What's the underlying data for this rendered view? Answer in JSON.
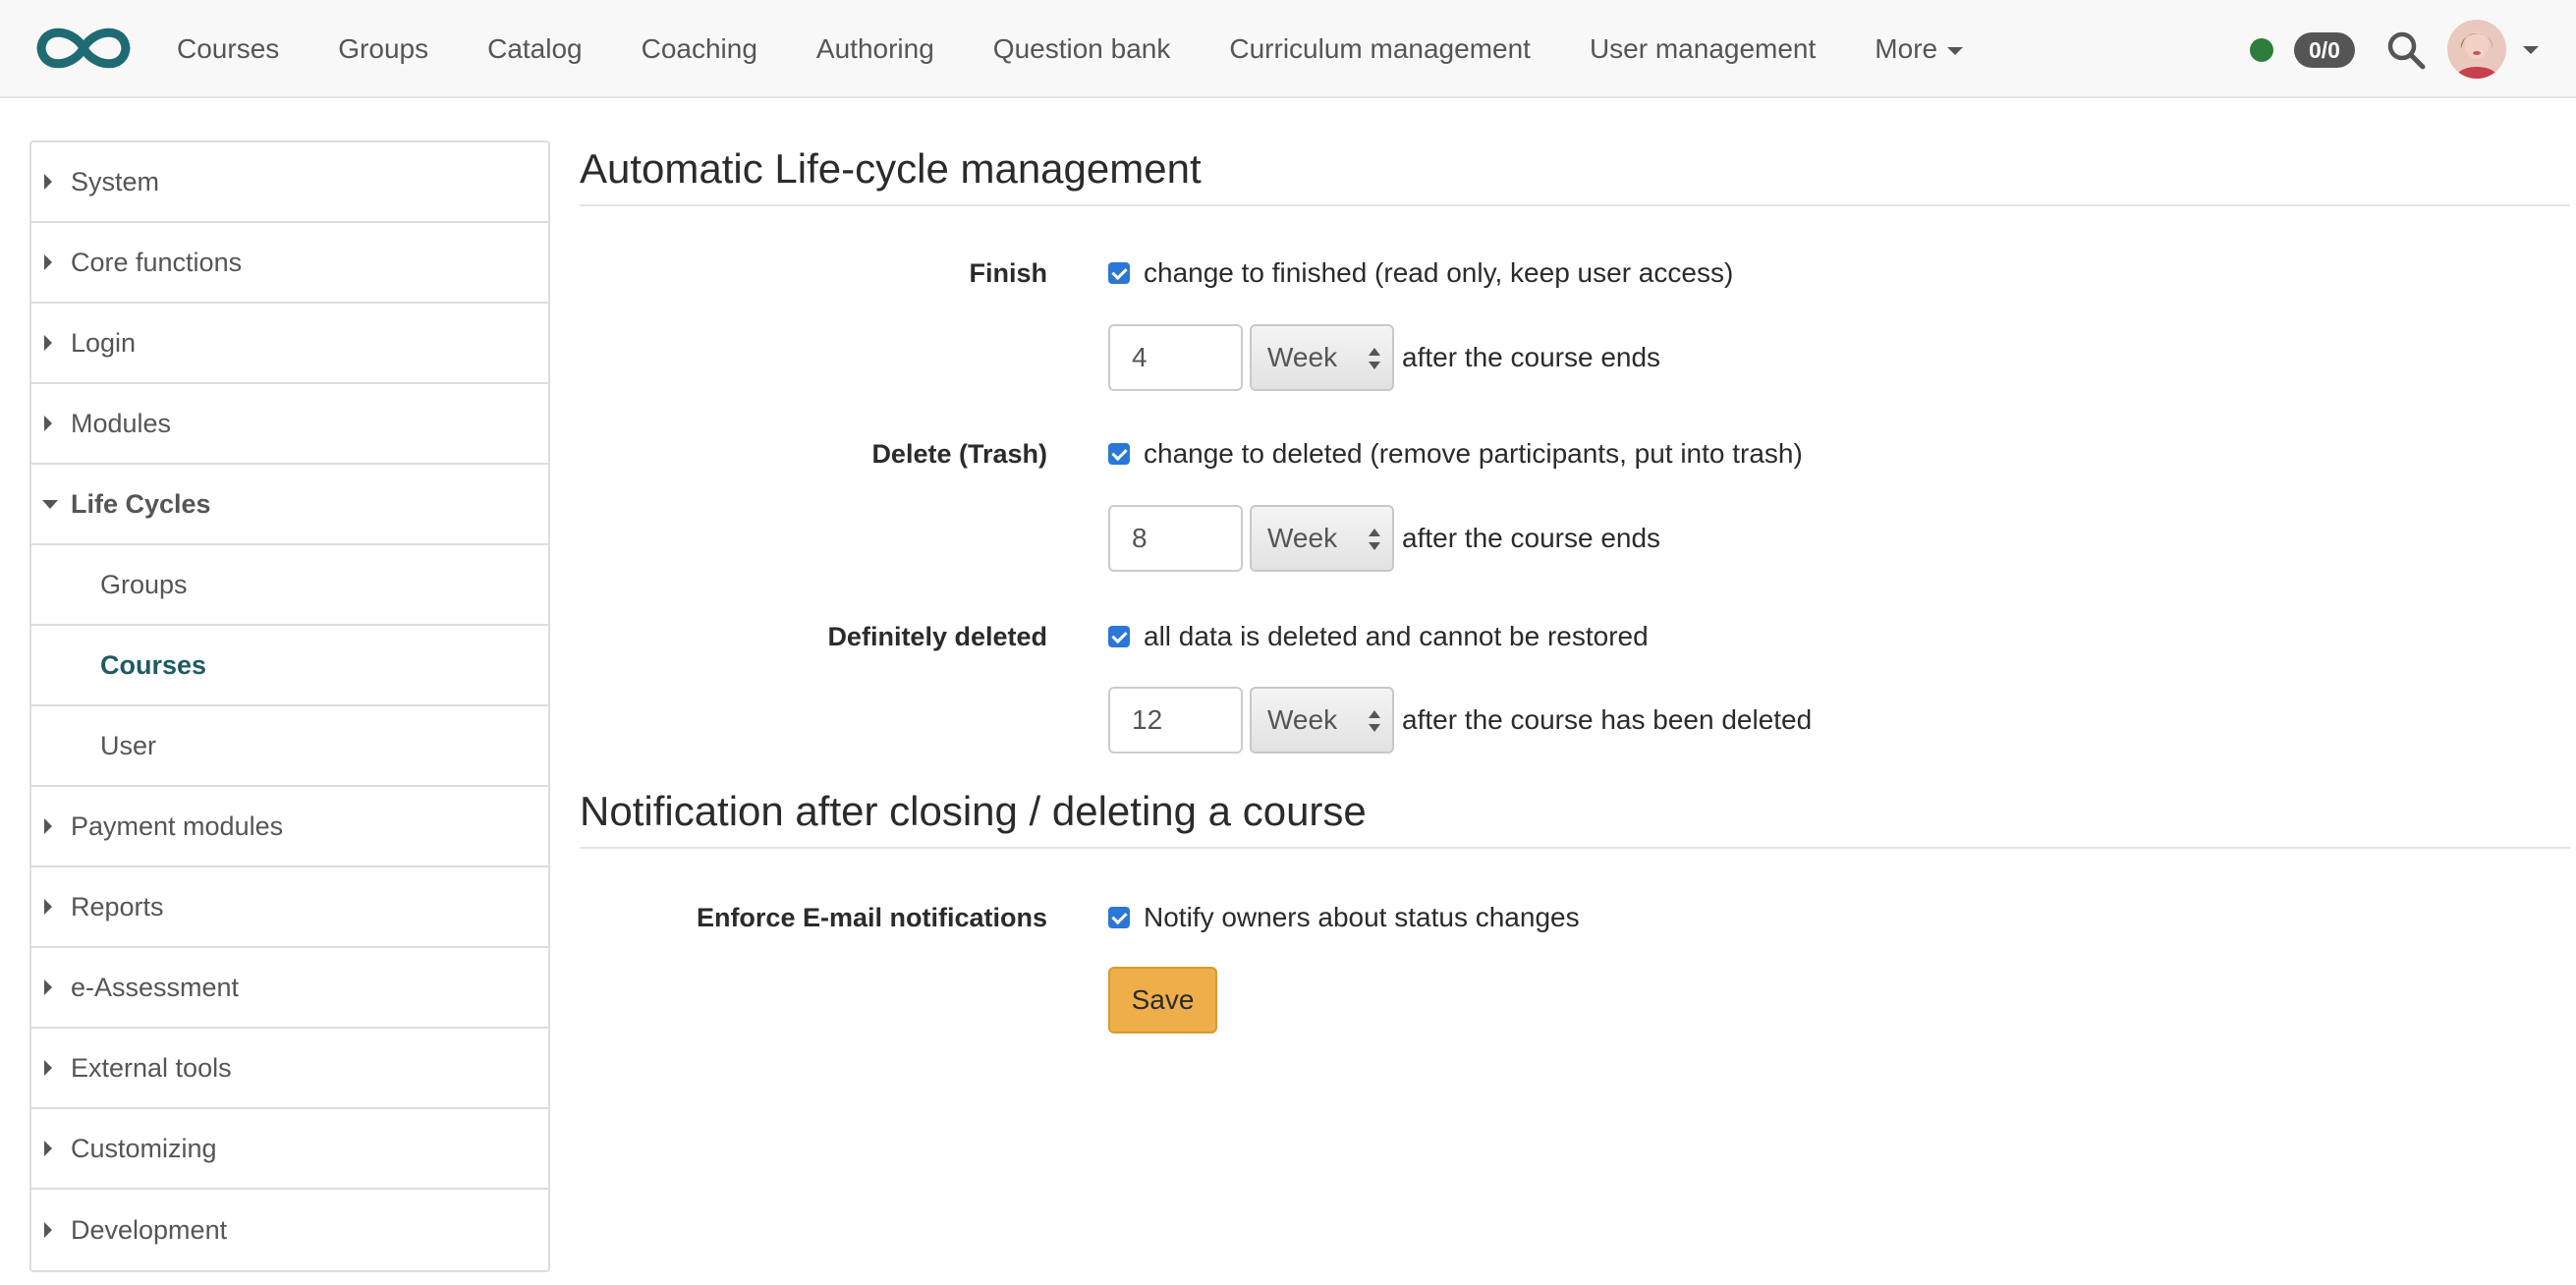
{
  "topnav": {
    "items": [
      "Courses",
      "Groups",
      "Catalog",
      "Coaching",
      "Authoring",
      "Question bank",
      "Curriculum management",
      "User management"
    ],
    "more_label": "More",
    "counter": "0/0",
    "status_color": "#2e7d3a",
    "logo_icon": "infinity-logo-icon",
    "search_icon": "search-icon"
  },
  "sidebar": {
    "items": [
      {
        "label": "System"
      },
      {
        "label": "Core functions"
      },
      {
        "label": "Login"
      },
      {
        "label": "Modules"
      },
      {
        "label": "Life Cycles"
      },
      {
        "label": "Groups"
      },
      {
        "label": "Courses"
      },
      {
        "label": "User"
      },
      {
        "label": "Payment modules"
      },
      {
        "label": "Reports"
      },
      {
        "label": "e-Assessment"
      },
      {
        "label": "External tools"
      },
      {
        "label": "Customizing"
      },
      {
        "label": "Development"
      }
    ]
  },
  "lifecycle": {
    "title": "Automatic Life-cycle management",
    "finish": {
      "label": "Finish",
      "checkbox_text": "change to finished (read only, keep user access)",
      "checked": true,
      "value": "4",
      "unit": "Week",
      "after_text": "after the course ends"
    },
    "delete": {
      "label": "Delete (Trash)",
      "checkbox_text": "change to deleted (remove participants, put into trash)",
      "checked": true,
      "value": "8",
      "unit": "Week",
      "after_text": "after the course ends"
    },
    "definitely": {
      "label": "Definitely deleted",
      "checkbox_text": "all data is deleted and cannot be restored",
      "checked": true,
      "value": "12",
      "unit": "Week",
      "after_text": "after the course has been deleted"
    }
  },
  "notification": {
    "title": "Notification after closing / deleting a course",
    "label": "Enforce E-mail notifications",
    "checkbox_text": "Notify owners about status changes",
    "checked": true,
    "save_label": "Save"
  },
  "colors": {
    "accent": "#1f5b63",
    "checkbox": "#2a77d6",
    "save_button": "#eeae4a",
    "logo": "#1f6b73"
  }
}
